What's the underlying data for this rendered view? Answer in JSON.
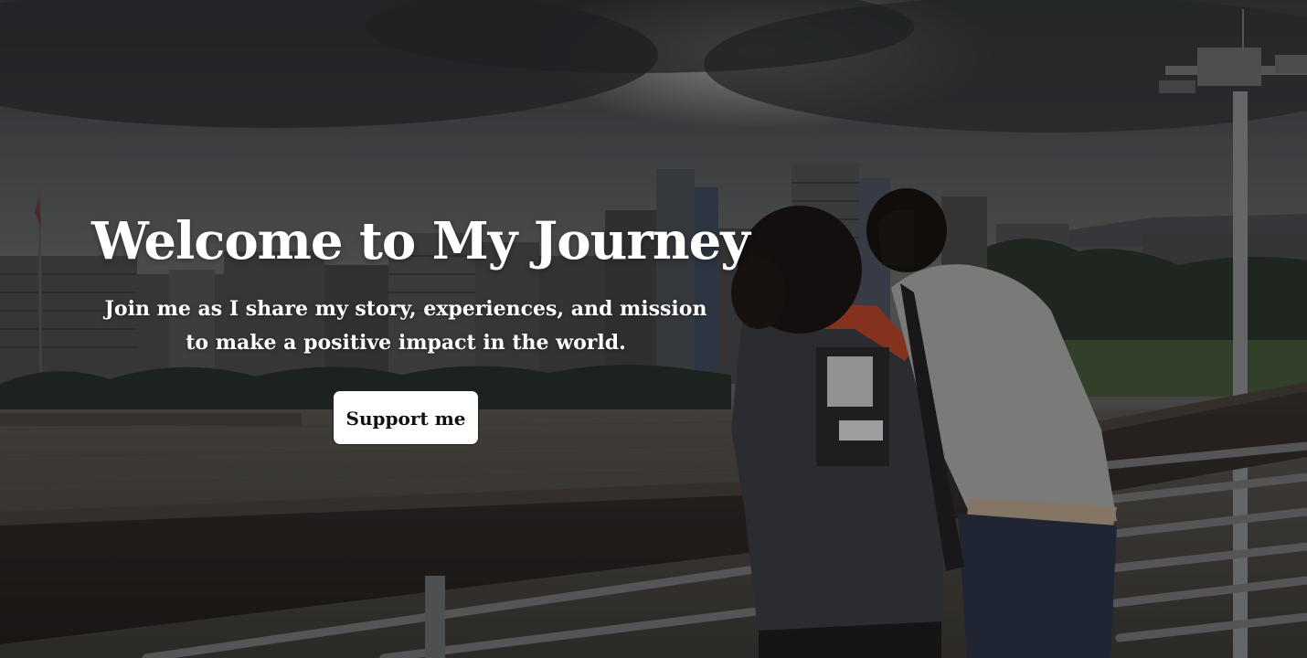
{
  "hero": {
    "title": "Welcome to My Journey",
    "subtitle": "Join me as I share my story, experiences, and mission to make a positive impact in the world.",
    "cta_label": "Support me",
    "text_color": "#ffffff",
    "button_background": "#ffffff",
    "button_text_color": "#111111"
  }
}
